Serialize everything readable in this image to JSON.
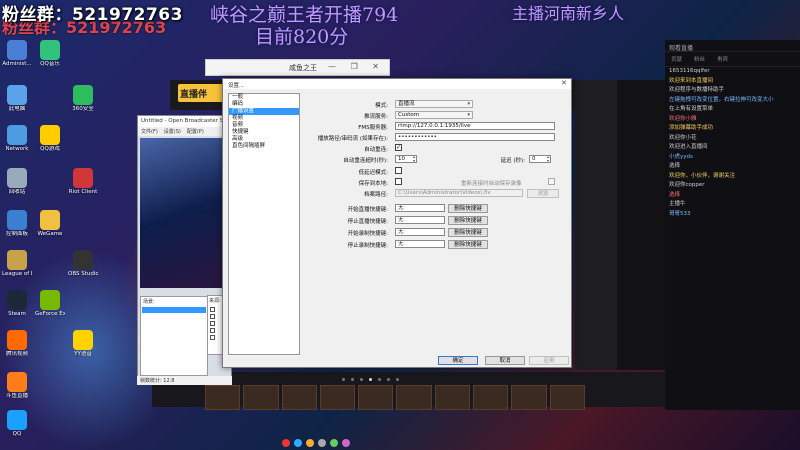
{
  "overlay": {
    "fans": "粉丝群：521972763",
    "title": "峡谷之巅王者开播794",
    "score": "目前820分",
    "host": "主播河南新乡人"
  },
  "desktop_icons": [
    {
      "label": "Administ...",
      "color": "#4a7fd6"
    },
    {
      "label": "此电脑",
      "color": "#5ba3e8"
    },
    {
      "label": "Network",
      "color": "#4d9be0"
    },
    {
      "label": "回收站",
      "color": "#9ab"
    },
    {
      "label": "控制面板",
      "color": "#3a7fd0"
    },
    {
      "label": "League of Legends",
      "color": "#c8a24a"
    },
    {
      "label": "Steam",
      "color": "#1b2838"
    },
    {
      "label": "腾讯视频",
      "color": "#ff6a00"
    },
    {
      "label": "斗鱼直播",
      "color": "#ff7d1a"
    },
    {
      "label": "QQ",
      "color": "#1aa1ff"
    },
    {
      "label": "QQ音乐",
      "color": "#31c27c"
    },
    {
      "label": "QQ游戏",
      "color": "#ffcc00"
    },
    {
      "label": "WeGame",
      "color": "#f0c040"
    },
    {
      "label": "GeForce Experience",
      "color": "#76b900"
    },
    {
      "label": "360安全",
      "color": "#2dbd5f"
    },
    {
      "label": "Riot Client",
      "color": "#d13639"
    },
    {
      "label": "OBS Studio",
      "color": "#333"
    },
    {
      "label": "YY语音",
      "color": "#ffd200"
    }
  ],
  "launcher": {
    "title": "咸鱼之王",
    "controls": "— ❐ ✕"
  },
  "client": {
    "logo": "直播伴"
  },
  "obs": {
    "title": "Untitled - Open Broadcaster So",
    "menu": [
      "文件(F)",
      "设置(S)",
      "配置(P)"
    ],
    "scenes_label": "场景:",
    "sources_label": "来源:",
    "status": "帧数统计: 12.8"
  },
  "settings": {
    "title": "设置...",
    "close": "✕",
    "nav": [
      {
        "label": "一般",
        "active": false
      },
      {
        "label": "编码",
        "active": false
      },
      {
        "label": "广播设置",
        "active": true
      },
      {
        "label": "视频",
        "active": false
      },
      {
        "label": "音频",
        "active": false
      },
      {
        "label": "快捷键",
        "active": false
      },
      {
        "label": "高级",
        "active": false
      },
      {
        "label": "直色间隔插屏",
        "active": false
      }
    ],
    "fields": {
      "mode_label": "模式:",
      "mode_value": "直播流",
      "service_label": "推流服务:",
      "service_value": "Custom",
      "server_label": "FMS服务器:",
      "server_value": "rtmp://127.0.0.1:1935/live",
      "key_label": "播放路径/串码流 (如果存在):",
      "key_value": "••••••••••••",
      "autoreconnect_label": "自动重连:",
      "autoreconnect_checked": "✓",
      "reconnect_timeout_label": "自动重连超时(秒):",
      "reconnect_timeout_value": "10",
      "delay_label": "延迟 (秒):",
      "delay_value": "0",
      "lowlatency_label": "低延迟模式:",
      "keep_recording_label": "保存到本地:",
      "keep_replay_label": "重新连接时自动保存录像",
      "file_path_label": "档案路径:",
      "file_path_value": "C:\\Users\\Administrator\\Videos\\.flv",
      "browse_label": "浏览",
      "start_stream_hotkey_label": "开始直播快捷键:",
      "stop_stream_hotkey_label": "停止直播快捷键:",
      "start_rec_hotkey_label": "开始录制快捷键:",
      "stop_rec_hotkey_label": "停止录制快捷键:",
      "hotkey_value": "无",
      "clear_hotkey_label": "删除快捷键"
    },
    "buttons": {
      "ok": "确定",
      "cancel": "取消",
      "apply": "应用"
    }
  },
  "chat": {
    "header": "观看直播",
    "tabs": [
      "贡献",
      "粉丝",
      "贵宾"
    ],
    "lines": [
      {
        "text": "1653116qqlfer",
        "style": ""
      },
      {
        "text": "欢迎来到本直播间",
        "style": "hl"
      },
      {
        "text": "欢迎程序与数播特助手",
        "style": ""
      },
      {
        "text": "左键拖拽可改变位置，右键拉伸可改变大小",
        "style": "blue"
      },
      {
        "text": "在上角有设置菜单",
        "style": ""
      },
      {
        "text": "欢迎你小雅",
        "style": "red"
      },
      {
        "text": "添加弹幕助手成功",
        "style": "hl"
      },
      {
        "text": "欢迎你小花",
        "style": ""
      },
      {
        "text": "欢迎进入直播间",
        "style": ""
      },
      {
        "text": "小虎yyds",
        "style": "blue"
      },
      {
        "text": "选择",
        "style": ""
      },
      {
        "text": "欢迎你，小伙伴，谢谢关注",
        "style": "hl"
      },
      {
        "text": "欢迎你copper",
        "style": ""
      },
      {
        "text": "选择",
        "style": "red"
      },
      {
        "text": "主播牛",
        "style": ""
      },
      {
        "text": "哥哥533",
        "style": "blue"
      }
    ]
  }
}
